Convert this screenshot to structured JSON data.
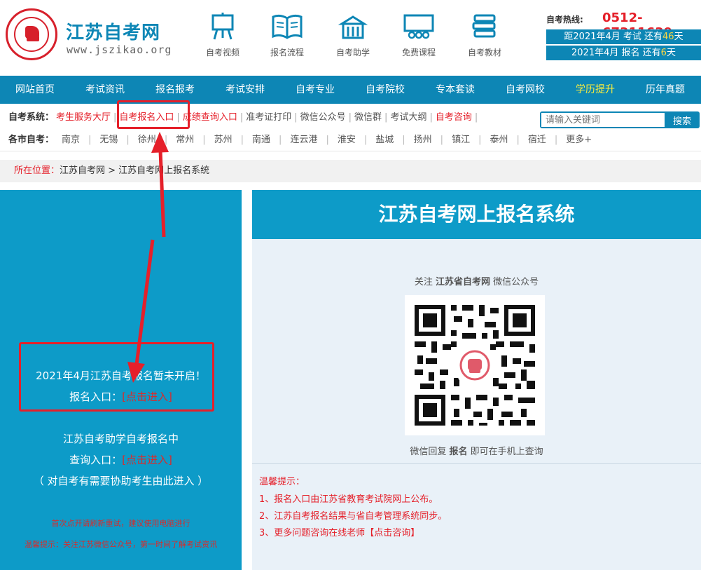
{
  "header": {
    "site_name": "江苏自考网",
    "site_url": "www.jszikao.org",
    "quick_links": [
      {
        "label": "自考视频",
        "icon": "easel-icon"
      },
      {
        "label": "报名流程",
        "icon": "open-book-icon"
      },
      {
        "label": "自考助学",
        "icon": "building-icon"
      },
      {
        "label": "免费课程",
        "icon": "classroom-icon"
      },
      {
        "label": "自考教材",
        "icon": "books-stack-icon"
      }
    ],
    "hotline_label": "自考热线:",
    "hotline_number": "0512-67311639",
    "countdown_exam": {
      "prefix": "距2021年4月 考试 还有",
      "days": "46",
      "suffix": "天"
    },
    "countdown_reg": {
      "prefix": "2021年4月 报名 还有",
      "days": "6",
      "suffix": "天"
    }
  },
  "nav": {
    "items": [
      "网站首页",
      "考试资讯",
      "报名报考",
      "考试安排",
      "自考专业",
      "自考院校",
      "专本套读",
      "自考网校",
      "学历提升",
      "历年真题"
    ],
    "highlight_index": 8
  },
  "system_row": {
    "label": "自考系统：",
    "items": [
      {
        "text": "考生服务大厅",
        "red": true
      },
      {
        "text": "自考报名入口",
        "red": true
      },
      {
        "text": "成绩查询入口",
        "red": true
      },
      {
        "text": "准考证打印",
        "red": false
      },
      {
        "text": "微信公众号",
        "red": false
      },
      {
        "text": "微信群",
        "red": false
      },
      {
        "text": "考试大纲",
        "red": false
      },
      {
        "text": "自考咨询",
        "red": true
      }
    ],
    "search_placeholder": "请输入关键词",
    "search_button": "搜索"
  },
  "city_row": {
    "label": "各市自考：",
    "items": [
      "南京",
      "无锡",
      "徐州",
      "常州",
      "苏州",
      "南通",
      "连云港",
      "淮安",
      "盐城",
      "扬州",
      "镇江",
      "泰州",
      "宿迁",
      "更多+"
    ]
  },
  "breadcrumb": {
    "label": "所在位置：",
    "path": "江苏自考网 > 江苏自考网上报名系统"
  },
  "left_panel": {
    "notice": "2021年4月江苏自考报名暂未开启！",
    "entry_label": "报名入口：",
    "entry_link": "[点击进入]",
    "assist_title": "江苏自考助学自考报名中",
    "query_label": "查询入口：",
    "query_link": "[点击进入]",
    "assist_note": "（ 对自考有需要协助考生由此进入 ）",
    "tip1": "首次点开请刷新重试，建议使用电脑进行",
    "tip2": "温馨提示：关注江苏微信公众号，第一时间了解考试资讯"
  },
  "right_panel": {
    "title": "江苏自考网上报名系统",
    "follow_prefix": "关注",
    "follow_name": "江苏省自考网",
    "follow_suffix": "微信公众号",
    "reply_prefix": "微信回复",
    "reply_keyword": "报名",
    "reply_suffix": "即可在手机上查询",
    "tips_title": "温馨提示：",
    "tips": [
      "1、报名入口由江苏省教育考试院网上公布。",
      "2、江苏自考报名结果与省自考管理系统同步。",
      "3、更多问题咨询在线老师【点击咨询】"
    ]
  },
  "colors": {
    "brand_blue": "#0d86b5",
    "panel_blue": "#0d9bc8",
    "accent_red": "#e5202a",
    "nav_highlight": "#ffef3b"
  }
}
